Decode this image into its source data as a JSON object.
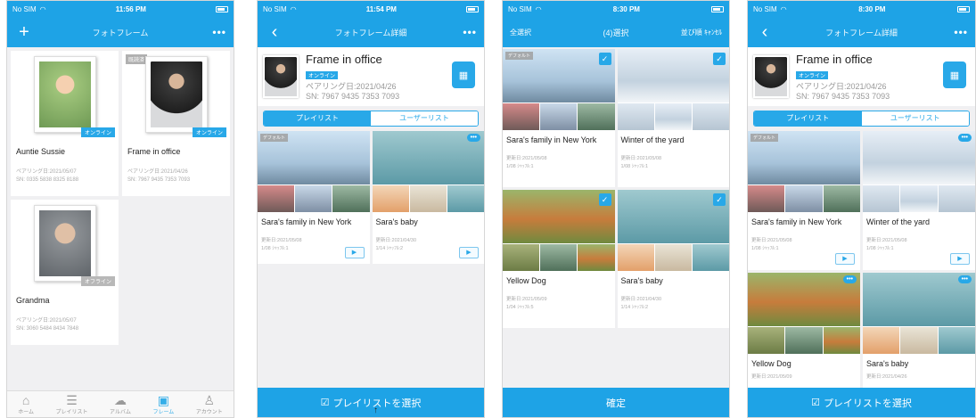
{
  "status": {
    "carrier": "No SIM",
    "times": [
      "11:56 PM",
      "11:54 PM",
      "8:30 PM",
      "8:30 PM"
    ]
  },
  "screen1": {
    "title": "フォトフレーム",
    "more": "•••",
    "add": "+",
    "frames": [
      {
        "name": "Auntie Sussie",
        "badge": "オンライン",
        "pair": "ペアリング日:2021/05/07",
        "sn": "SN: 0335 5838 8325 8188",
        "tone": "kid",
        "online": true
      },
      {
        "name": "Frame in office",
        "badge": "オンライン",
        "pair": "ペアリング日:2021/04/26",
        "sn": "SN: 7967 9435 7353 7093",
        "tone": "woman",
        "online": true,
        "tag": "既読済"
      },
      {
        "name": "Grandma",
        "badge": "オフライン",
        "pair": "ペアリング日:2021/05/07",
        "sn": "SN: 3060 5484 8434 7848",
        "tone": "oldman",
        "online": false
      }
    ],
    "tabs": [
      "ホーム",
      "プレイリスト",
      "アルバム",
      "フレーム",
      "アカウント"
    ]
  },
  "screen2": {
    "title": "フォトフレーム詳細",
    "device": {
      "name": "Frame in office",
      "status": "オンライン",
      "pair": "ペアリング日:2021/04/26",
      "sn": "SN: 7967 9435 7353 7093"
    },
    "segments": [
      "プレイリスト",
      "ユーザーリスト"
    ],
    "playlists": [
      {
        "name": "Sara's family in New York",
        "tag": "デフォルト",
        "date": "更新日:2021/05/08",
        "count": "1/08",
        "set": "ｼｬｯﾌﾙ:1"
      },
      {
        "name": "Sara's baby",
        "date": "更新日:2021/04/30",
        "count": "1/14",
        "set": "ｼｬｯﾌﾙ:2"
      }
    ],
    "select_button": "プレイリストを選択",
    "cursor": "↑"
  },
  "screen3": {
    "select_all": "全選択",
    "title": "(4)選択",
    "right": "並び順 ｷｬﾝｾﾙ",
    "playlists": [
      {
        "name": "Sara's family in New York",
        "date": "更新日:2021/05/08",
        "count": "1/08",
        "set": "ｼｬｯﾌﾙ:1"
      },
      {
        "name": "Winter of the yard",
        "date": "更新日:2021/05/08",
        "count": "1/08",
        "set": "ｼｬｯﾌﾙ:1"
      },
      {
        "name": "Yellow Dog",
        "date": "更新日:2021/05/09",
        "count": "1/04",
        "set": "ｼｬｯﾌﾙ:5"
      },
      {
        "name": "Sara's baby",
        "date": "更新日:2021/04/30",
        "count": "1/14",
        "set": "ｼｬｯﾌﾙ:2"
      }
    ],
    "confirm": "確定"
  },
  "screen4": {
    "title": "フォトフレーム詳細",
    "device": {
      "name": "Frame in office",
      "status": "オンライン",
      "pair": "ペアリング日:2021/04/26",
      "sn": "SN: 7967 9435 7353 7093"
    },
    "segments": [
      "プレイリスト",
      "ユーザーリスト"
    ],
    "playlists": [
      {
        "name": "Sara's family in New York",
        "date": "更新日:2021/05/08",
        "count": "1/08",
        "set": "ｼｬｯﾌﾙ:1"
      },
      {
        "name": "Winter of the yard",
        "date": "更新日:2021/05/08",
        "count": "1/08",
        "set": "ｼｬｯﾌﾙ:1"
      },
      {
        "name": "Yellow Dog",
        "date": "更新日:2021/05/09"
      },
      {
        "name": "Sara's baby",
        "date": "更新日:2021/04/26"
      }
    ],
    "select_button": "プレイリストを選択"
  },
  "colors": {
    "primary": "#1ea3e6",
    "accent": "#28a8e8",
    "background": "#f0f0f2"
  }
}
